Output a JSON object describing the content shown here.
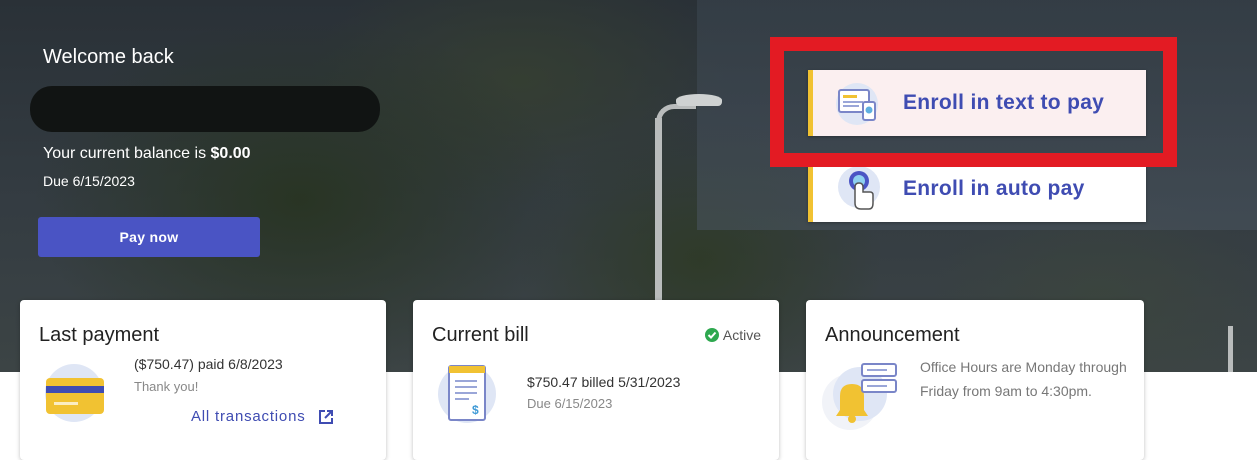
{
  "hero": {
    "welcome": "Welcome back",
    "balance_prefix": "Your current balance is ",
    "balance_amount": "$0.00",
    "due": "Due 6/15/2023",
    "pay_button": "Pay now"
  },
  "enroll": {
    "text_to_pay": {
      "label": "Enroll in text to pay",
      "icon": "text-pay-icon"
    },
    "auto_pay": {
      "label": "Enroll in auto pay",
      "icon": "auto-pay-icon"
    },
    "highlight_color": "#e31b23",
    "accent_color": "#f1c232"
  },
  "last_payment": {
    "title": "Last payment",
    "amount": "($750.47) paid 6/8/2023",
    "note": "Thank you!",
    "link": "All transactions",
    "icon": "credit-card-icon"
  },
  "current_bill": {
    "title": "Current bill",
    "status": "Active",
    "billed": "$750.47 billed 5/31/2023",
    "due": "Due 6/15/2023",
    "icon": "bill-document-icon"
  },
  "announcement": {
    "title": "Announcement",
    "text": "Office Hours are Monday through Friday from 9am to 4:30pm.",
    "icon": "bell-icon"
  },
  "colors": {
    "primary": "#4a54c4",
    "link": "#3f4cb2",
    "active": "#2ea84f"
  }
}
